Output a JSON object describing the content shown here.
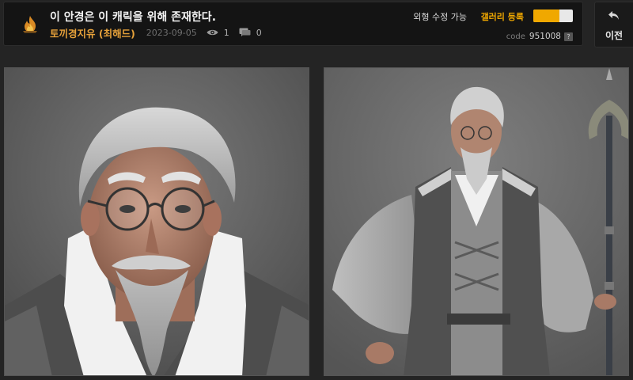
{
  "post": {
    "title": "이 안경은 이 캐릭을 위해 존재한다.",
    "author": "토끼경지유 (최해드)",
    "date": "2023-09-05",
    "views": "1",
    "comments": "0"
  },
  "options": {
    "appearance_editable_label": "외형 수정 가능",
    "gallery_register_label": "갤러리 등록",
    "gallery_toggle_level": 0.65,
    "code_label": "code",
    "code_value": "951008",
    "help_glyph": "?"
  },
  "nav": {
    "back_label": "이전"
  },
  "colors": {
    "accent": "#f0a800",
    "author": "#e6a13a",
    "background": "#242424"
  },
  "icons": [
    "flame-logo-icon",
    "eye-icon",
    "comment-icon",
    "back-arrow-icon",
    "help-icon"
  ]
}
